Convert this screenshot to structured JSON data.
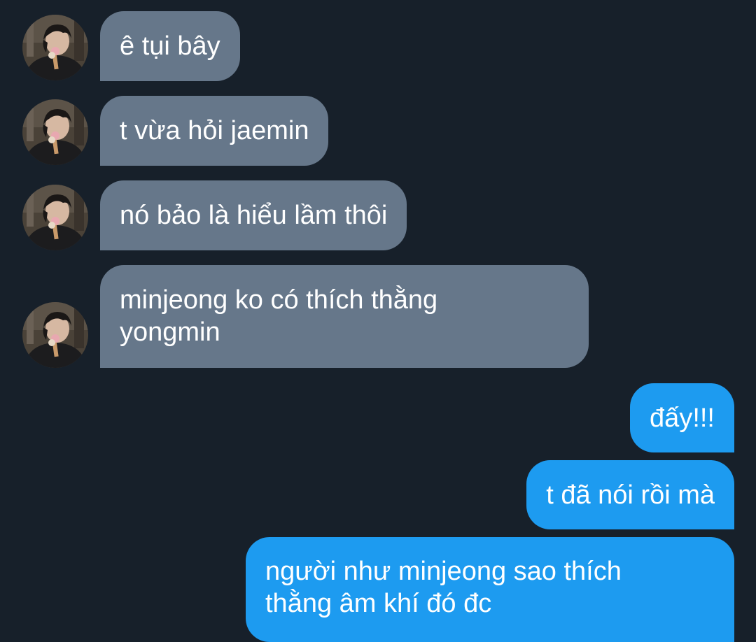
{
  "messages": [
    {
      "side": "in",
      "text": [
        "ê tụi bây"
      ]
    },
    {
      "side": "in",
      "text": [
        "t vừa hỏi jaemin"
      ]
    },
    {
      "side": "in",
      "text": [
        "nó bảo là hiểu lầm thôi"
      ]
    },
    {
      "side": "in",
      "text": [
        "minjeong ko có thích thằng",
        "yongmin"
      ]
    },
    {
      "side": "out",
      "text": [
        "đấy!!!"
      ]
    },
    {
      "side": "out",
      "text": [
        "t đã nói rồi mà"
      ]
    },
    {
      "side": "out",
      "text": [
        "người như minjeong sao thích",
        "thằng âm khí đó đc"
      ]
    }
  ],
  "colors": {
    "background": "#17202a",
    "incoming_bubble": "#66778a",
    "outgoing_bubble": "#1d9bf0",
    "text": "#ffffff"
  },
  "icons": {
    "avatar": "contact-avatar-photo"
  }
}
